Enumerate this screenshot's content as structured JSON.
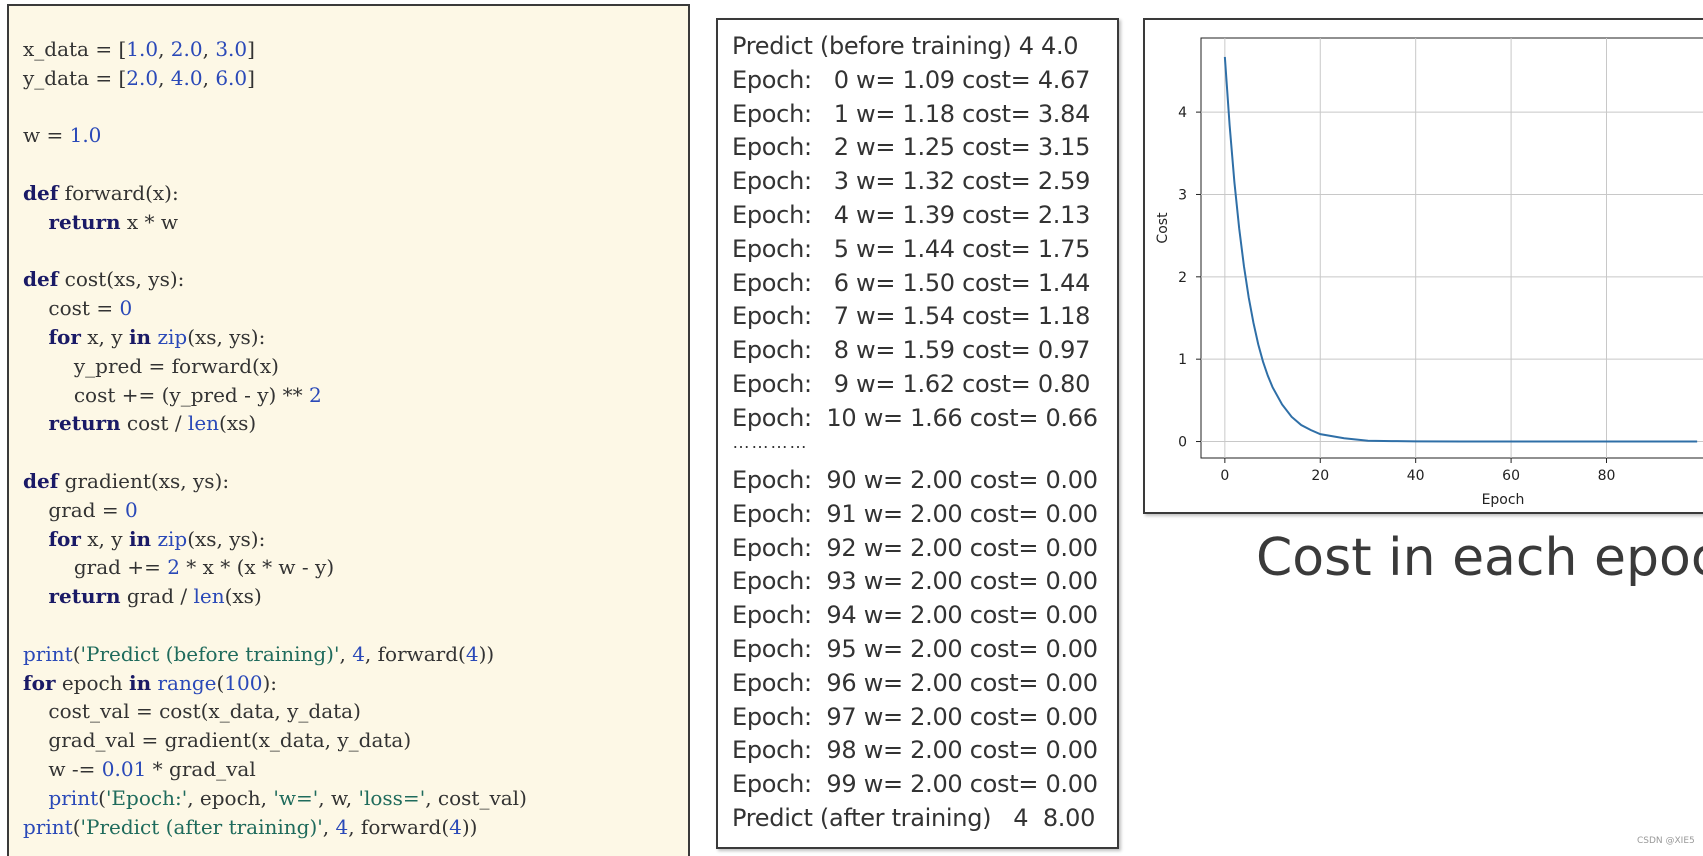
{
  "code_lines": [
    [
      [
        "tx",
        "x_data = ["
      ],
      [
        "num",
        "1.0"
      ],
      [
        "tx",
        ", "
      ],
      [
        "num",
        "2.0"
      ],
      [
        "tx",
        ", "
      ],
      [
        "num",
        "3.0"
      ],
      [
        "tx",
        "]"
      ]
    ],
    [
      [
        "tx",
        "y_data = ["
      ],
      [
        "num",
        "2.0"
      ],
      [
        "tx",
        ", "
      ],
      [
        "num",
        "4.0"
      ],
      [
        "tx",
        ", "
      ],
      [
        "num",
        "6.0"
      ],
      [
        "tx",
        "]"
      ]
    ],
    [],
    [
      [
        "tx",
        "w = "
      ],
      [
        "num",
        "1.0"
      ]
    ],
    [],
    [
      [
        "kw",
        "def"
      ],
      [
        "tx",
        " forward(x):"
      ]
    ],
    [
      [
        "tx",
        "    "
      ],
      [
        "kw",
        "return"
      ],
      [
        "tx",
        " x * w"
      ]
    ],
    [],
    [
      [
        "kw",
        "def"
      ],
      [
        "tx",
        " cost(xs, ys):"
      ]
    ],
    [
      [
        "tx",
        "    cost = "
      ],
      [
        "num",
        "0"
      ]
    ],
    [
      [
        "tx",
        "    "
      ],
      [
        "kw",
        "for"
      ],
      [
        "tx",
        " x, y "
      ],
      [
        "kw",
        "in"
      ],
      [
        "tx",
        " "
      ],
      [
        "bi",
        "zip"
      ],
      [
        "tx",
        "(xs, ys):"
      ]
    ],
    [
      [
        "tx",
        "        y_pred = forward(x)"
      ]
    ],
    [
      [
        "tx",
        "        cost += (y_pred - y) ** "
      ],
      [
        "num",
        "2"
      ]
    ],
    [
      [
        "tx",
        "    "
      ],
      [
        "kw",
        "return"
      ],
      [
        "tx",
        " cost / "
      ],
      [
        "bi",
        "len"
      ],
      [
        "tx",
        "(xs)"
      ]
    ],
    [],
    [
      [
        "kw",
        "def"
      ],
      [
        "tx",
        " gradient(xs, ys):"
      ]
    ],
    [
      [
        "tx",
        "    grad = "
      ],
      [
        "num",
        "0"
      ]
    ],
    [
      [
        "tx",
        "    "
      ],
      [
        "kw",
        "for"
      ],
      [
        "tx",
        " x, y "
      ],
      [
        "kw",
        "in"
      ],
      [
        "tx",
        " "
      ],
      [
        "bi",
        "zip"
      ],
      [
        "tx",
        "(xs, ys):"
      ]
    ],
    [
      [
        "tx",
        "        grad += "
      ],
      [
        "num",
        "2"
      ],
      [
        "tx",
        " * x * (x * w - y)"
      ]
    ],
    [
      [
        "tx",
        "    "
      ],
      [
        "kw",
        "return"
      ],
      [
        "tx",
        " grad / "
      ],
      [
        "bi",
        "len"
      ],
      [
        "tx",
        "(xs)"
      ]
    ],
    [],
    [
      [
        "bi",
        "print"
      ],
      [
        "tx",
        "("
      ],
      [
        "str",
        "'Predict (before training)'"
      ],
      [
        "tx",
        ", "
      ],
      [
        "num",
        "4"
      ],
      [
        "tx",
        ", forward("
      ],
      [
        "num",
        "4"
      ],
      [
        "tx",
        "))"
      ]
    ],
    [
      [
        "kw",
        "for"
      ],
      [
        "tx",
        " epoch "
      ],
      [
        "kw",
        "in"
      ],
      [
        "tx",
        " "
      ],
      [
        "bi",
        "range"
      ],
      [
        "tx",
        "("
      ],
      [
        "num",
        "100"
      ],
      [
        "tx",
        "):"
      ]
    ],
    [
      [
        "tx",
        "    cost_val = cost(x_data, y_data)"
      ]
    ],
    [
      [
        "tx",
        "    grad_val = gradient(x_data, y_data)"
      ]
    ],
    [
      [
        "tx",
        "    w -= "
      ],
      [
        "num",
        "0.01"
      ],
      [
        "tx",
        " * grad_val"
      ]
    ],
    [
      [
        "tx",
        "    "
      ],
      [
        "bi",
        "print"
      ],
      [
        "tx",
        "("
      ],
      [
        "str",
        "'Epoch:'"
      ],
      [
        "tx",
        ", epoch, "
      ],
      [
        "str",
        "'w='"
      ],
      [
        "tx",
        ", w, "
      ],
      [
        "str",
        "'loss='"
      ],
      [
        "tx",
        ", cost_val)"
      ]
    ],
    [
      [
        "bi",
        "print"
      ],
      [
        "tx",
        "("
      ],
      [
        "str",
        "'Predict (after training)'"
      ],
      [
        "tx",
        ", "
      ],
      [
        "num",
        "4"
      ],
      [
        "tx",
        ", forward("
      ],
      [
        "num",
        "4"
      ],
      [
        "tx",
        "))"
      ]
    ]
  ],
  "output_lines_top": [
    "Predict (before training) 4 4.0",
    "Epoch:   0 w= 1.09 cost= 4.67",
    "Epoch:   1 w= 1.18 cost= 3.84",
    "Epoch:   2 w= 1.25 cost= 3.15",
    "Epoch:   3 w= 1.32 cost= 2.59",
    "Epoch:   4 w= 1.39 cost= 2.13",
    "Epoch:   5 w= 1.44 cost= 1.75",
    "Epoch:   6 w= 1.50 cost= 1.44",
    "Epoch:   7 w= 1.54 cost= 1.18",
    "Epoch:   8 w= 1.59 cost= 0.97",
    "Epoch:   9 w= 1.62 cost= 0.80",
    "Epoch:  10 w= 1.66 cost= 0.66"
  ],
  "output_ellipsis": "…………",
  "output_lines_bottom": [
    "Epoch:  90 w= 2.00 cost= 0.00",
    "Epoch:  91 w= 2.00 cost= 0.00",
    "Epoch:  92 w= 2.00 cost= 0.00",
    "Epoch:  93 w= 2.00 cost= 0.00",
    "Epoch:  94 w= 2.00 cost= 0.00",
    "Epoch:  95 w= 2.00 cost= 0.00",
    "Epoch:  96 w= 2.00 cost= 0.00",
    "Epoch:  97 w= 2.00 cost= 0.00",
    "Epoch:  98 w= 2.00 cost= 0.00",
    "Epoch:  99 w= 2.00 cost= 0.00",
    "Predict (after training)   4  8.00"
  ],
  "chart_data": {
    "type": "line",
    "title": "",
    "xlabel": "Epoch",
    "ylabel": "Cost",
    "xlim": [
      -5,
      104
    ],
    "ylim": [
      -0.2,
      4.9
    ],
    "x_ticks": [
      0,
      20,
      40,
      60,
      80
    ],
    "y_ticks": [
      0,
      1,
      2,
      3,
      4
    ],
    "grid": true,
    "line_color": "#2f6fa7",
    "series": [
      {
        "x": [
          0,
          1,
          2,
          3,
          4,
          5,
          6,
          7,
          8,
          9,
          10,
          12,
          14,
          16,
          18,
          20,
          25,
          30,
          35,
          40,
          50,
          60,
          70,
          80,
          90,
          99
        ],
        "y": [
          4.67,
          3.84,
          3.15,
          2.59,
          2.13,
          1.75,
          1.44,
          1.18,
          0.97,
          0.8,
          0.66,
          0.45,
          0.3,
          0.2,
          0.14,
          0.09,
          0.04,
          0.01,
          0.005,
          0.002,
          0.0005,
          0.0001,
          0,
          0,
          0,
          0
        ]
      }
    ]
  },
  "caption": "Cost in each epoch",
  "watermark": "CSDN @XIE5"
}
